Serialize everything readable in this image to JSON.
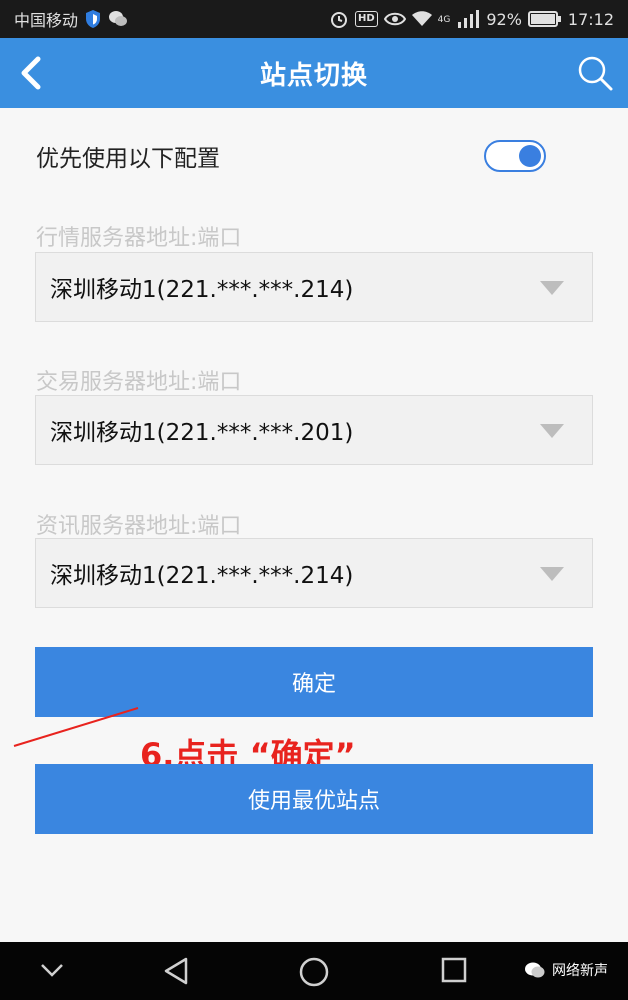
{
  "status_bar": {
    "carrier": "中国移动",
    "battery_percent": "92%",
    "time": "17:12",
    "hd": "HD",
    "network": "4G",
    "icons": [
      "shield-icon",
      "wechat-icon",
      "alarm-icon",
      "eye-icon",
      "wifi-icon",
      "signal-icon",
      "battery-icon"
    ]
  },
  "header": {
    "title": "站点切换",
    "back_icon": "chevron-left-icon",
    "search_icon": "search-icon",
    "background": "#3a8fe0"
  },
  "preference": {
    "label": "优先使用以下配置",
    "toggle_on": true
  },
  "fields": [
    {
      "label": "行情服务器地址:端口",
      "value": "深圳移动1(221.***.***.214)"
    },
    {
      "label": "交易服务器地址:端口",
      "value": "深圳移动1(221.***.***.201)"
    },
    {
      "label": "资讯服务器地址:端口",
      "value": "深圳移动1(221.***.***.214)"
    }
  ],
  "buttons": {
    "confirm": "确定",
    "best_site": "使用最优站点",
    "color": "#3a86e0"
  },
  "annotation": {
    "text": "6.点击 “确定”",
    "color": "#e8231e"
  },
  "nav_bar": {
    "icons": [
      "chevron-down-icon",
      "back-triangle-icon",
      "home-circle-icon",
      "recent-square-icon"
    ],
    "watermark": "网络新声"
  }
}
